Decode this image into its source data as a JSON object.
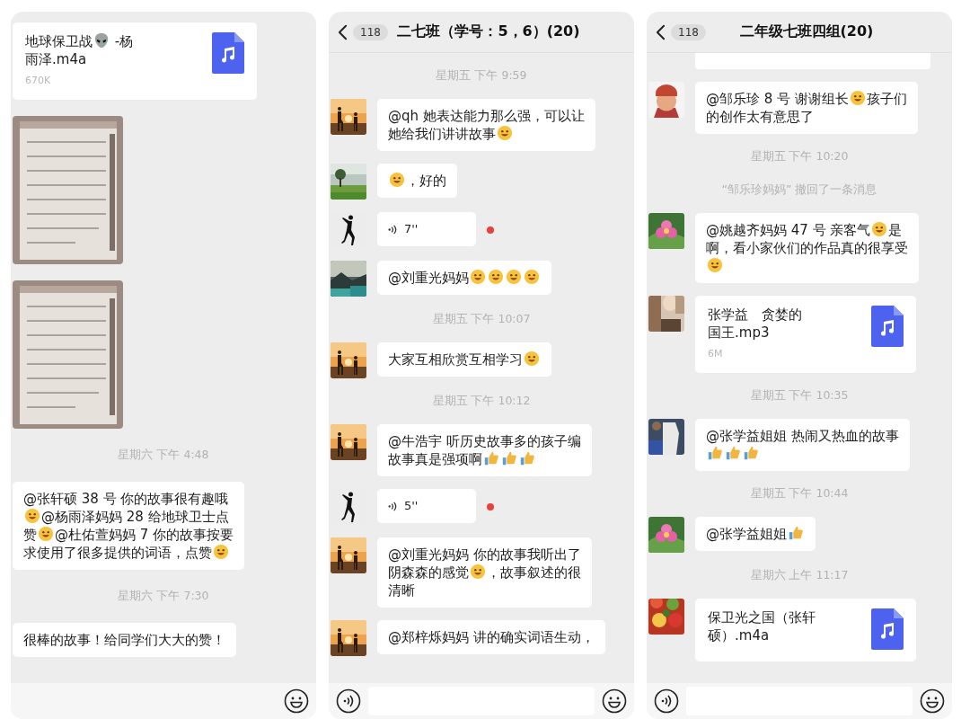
{
  "panels": [
    {
      "messages": [
        {
          "kind": "file",
          "lines": [
            [
              {
                "kind": "text",
                "text": "地球保卫战"
              },
              {
                "kind": "alien"
              },
              {
                "kind": "text",
                "text": " -杨"
              }
            ],
            [
              {
                "kind": "text",
                "text": "雨泽.m4a"
              }
            ]
          ],
          "size": "670K"
        },
        {
          "picture": {
            "kind": "picture"
          }
        },
        {
          "picture": {
            "kind": "picture"
          }
        },
        {
          "kind": "time",
          "text": "星期六 下午 4:48"
        },
        {
          "kind": "text",
          "lines": [
            [
              {
                "kind": "text",
                "text": "@张轩硕 38 号 你的故事很有趣哦"
              }
            ],
            [
              {
                "kind": "face"
              },
              {
                "kind": "text",
                "text": "@杨雨泽妈妈 28 给地球卫士点"
              }
            ],
            [
              {
                "kind": "text",
                "text": "赞"
              },
              {
                "kind": "face"
              },
              {
                "kind": "text",
                "text": "@杜佑萱妈妈 7 你的故事按要"
              }
            ],
            [
              {
                "kind": "text",
                "text": "求使用了很多提供的词语，点赞"
              },
              {
                "kind": "face"
              }
            ]
          ]
        },
        {
          "kind": "time",
          "text": "星期六 下午 7:30"
        },
        {
          "kind": "text",
          "lines": [
            [
              {
                "kind": "text",
                "text": "很棒的故事！给同学们大大的赞！"
              }
            ]
          ]
        }
      ],
      "input_bar": {
        "voice": false
      }
    },
    {
      "header": {
        "badge": "118",
        "title": "二七班（学号：5，6）(20)"
      },
      "messages": [
        {
          "kind": "time",
          "text": "星期五 下午 9:59"
        },
        {
          "kind": "text",
          "avatar": {
            "kind": "picture"
          },
          "lines": [
            [
              {
                "kind": "text",
                "text": "@qh 她表达能力那么强，可以让"
              }
            ],
            [
              {
                "kind": "text",
                "text": "她给我们讲讲故事"
              },
              {
                "kind": "face"
              }
            ]
          ]
        },
        {
          "kind": "text",
          "avatar": {
            "kind": "picture"
          },
          "lines": [
            [
              {
                "kind": "face"
              },
              {
                "kind": "text",
                "text": "，好的"
              }
            ]
          ]
        },
        {
          "kind": "voice",
          "avatar": {
            "kind": "picture"
          },
          "duration": "7''",
          "unread": true
        },
        {
          "kind": "text",
          "avatar": {
            "kind": "picture"
          },
          "lines": [
            [
              {
                "kind": "text",
                "text": "@刘重光妈妈"
              },
              {
                "kind": "face"
              },
              {
                "kind": "face"
              },
              {
                "kind": "face"
              },
              {
                "kind": "face"
              }
            ]
          ]
        },
        {
          "kind": "time",
          "text": "星期五 下午 10:07"
        },
        {
          "kind": "text",
          "avatar": {
            "kind": "picture"
          },
          "lines": [
            [
              {
                "kind": "text",
                "text": "大家互相欣赏互相学习"
              },
              {
                "kind": "face"
              }
            ]
          ]
        },
        {
          "kind": "time",
          "text": "星期五 下午 10:12"
        },
        {
          "kind": "text",
          "avatar": {
            "kind": "picture"
          },
          "lines": [
            [
              {
                "kind": "text",
                "text": "@牛浩宇 听历史故事多的孩子编"
              }
            ],
            [
              {
                "kind": "text",
                "text": "故事真是强项啊"
              },
              {
                "kind": "thumb"
              },
              {
                "kind": "thumb"
              },
              {
                "kind": "thumb"
              }
            ]
          ]
        },
        {
          "kind": "voice",
          "avatar": {
            "kind": "picture"
          },
          "duration": "5''",
          "unread": true
        },
        {
          "kind": "text",
          "avatar": {
            "kind": "picture"
          },
          "lines": [
            [
              {
                "kind": "text",
                "text": "@刘重光妈妈 你的故事我听出了"
              }
            ],
            [
              {
                "kind": "text",
                "text": "阴森森的感觉"
              },
              {
                "kind": "face"
              },
              {
                "kind": "text",
                "text": "，故事叙述的很"
              }
            ],
            [
              {
                "kind": "text",
                "text": "清晰"
              }
            ]
          ]
        },
        {
          "kind": "text",
          "avatar": {
            "kind": "picture"
          },
          "lines": [
            [
              {
                "kind": "text",
                "text": "@郑梓烁妈妈 讲的确实词语生动，"
              }
            ]
          ]
        }
      ],
      "input_bar": {
        "voice": true
      }
    },
    {
      "header": {
        "badge": "118",
        "title": "二年级七班四组(20)"
      },
      "messages": [
        {
          "kind": "stub"
        },
        {
          "kind": "text",
          "avatar": {
            "kind": "picture"
          },
          "lines": [
            [
              {
                "kind": "text",
                "text": "@邹乐珍 8 号 谢谢组长"
              },
              {
                "kind": "face"
              },
              {
                "kind": "text",
                "text": "孩子们"
              }
            ],
            [
              {
                "kind": "text",
                "text": "的创作太有意思了"
              }
            ]
          ]
        },
        {
          "kind": "time",
          "text": "星期五 下午 10:20"
        },
        {
          "kind": "notice",
          "text": "“邹乐珍妈妈” 撤回了一条消息"
        },
        {
          "kind": "text",
          "avatar": {
            "kind": "picture"
          },
          "lines": [
            [
              {
                "kind": "text",
                "text": "@姚越齐妈妈 47 号 亲客气"
              },
              {
                "kind": "face"
              },
              {
                "kind": "text",
                "text": "是"
              }
            ],
            [
              {
                "kind": "text",
                "text": "啊，看小家伙们的作品真的很享受"
              }
            ],
            [
              {
                "kind": "face"
              }
            ]
          ]
        },
        {
          "kind": "file",
          "avatar": {
            "kind": "picture"
          },
          "lines": [
            [
              {
                "kind": "text",
                "text": "张学益　贪婪的"
              }
            ],
            [
              {
                "kind": "text",
                "text": "国王.mp3"
              }
            ]
          ],
          "size": "6M"
        },
        {
          "kind": "time",
          "text": "星期五 下午 10:35"
        },
        {
          "kind": "text",
          "avatar": {
            "kind": "picture"
          },
          "lines": [
            [
              {
                "kind": "text",
                "text": "@张学益姐姐 热闹又热血的故事"
              }
            ],
            [
              {
                "kind": "thumb"
              },
              {
                "kind": "thumb"
              },
              {
                "kind": "thumb"
              }
            ]
          ]
        },
        {
          "kind": "time",
          "text": "星期五 下午 10:44"
        },
        {
          "kind": "text",
          "avatar": {
            "kind": "picture"
          },
          "lines": [
            [
              {
                "kind": "text",
                "text": "@张学益姐姐"
              },
              {
                "kind": "thumb"
              }
            ]
          ]
        },
        {
          "kind": "time",
          "text": "星期六 上午 11:17"
        },
        {
          "kind": "file",
          "avatar": {
            "kind": "picture"
          },
          "lines": [
            [
              {
                "kind": "text",
                "text": "保卫光之国（张轩"
              }
            ],
            [
              {
                "kind": "text",
                "text": "硕）.m4a"
              }
            ]
          ]
        }
      ],
      "input_bar": {
        "voice": true
      }
    }
  ]
}
